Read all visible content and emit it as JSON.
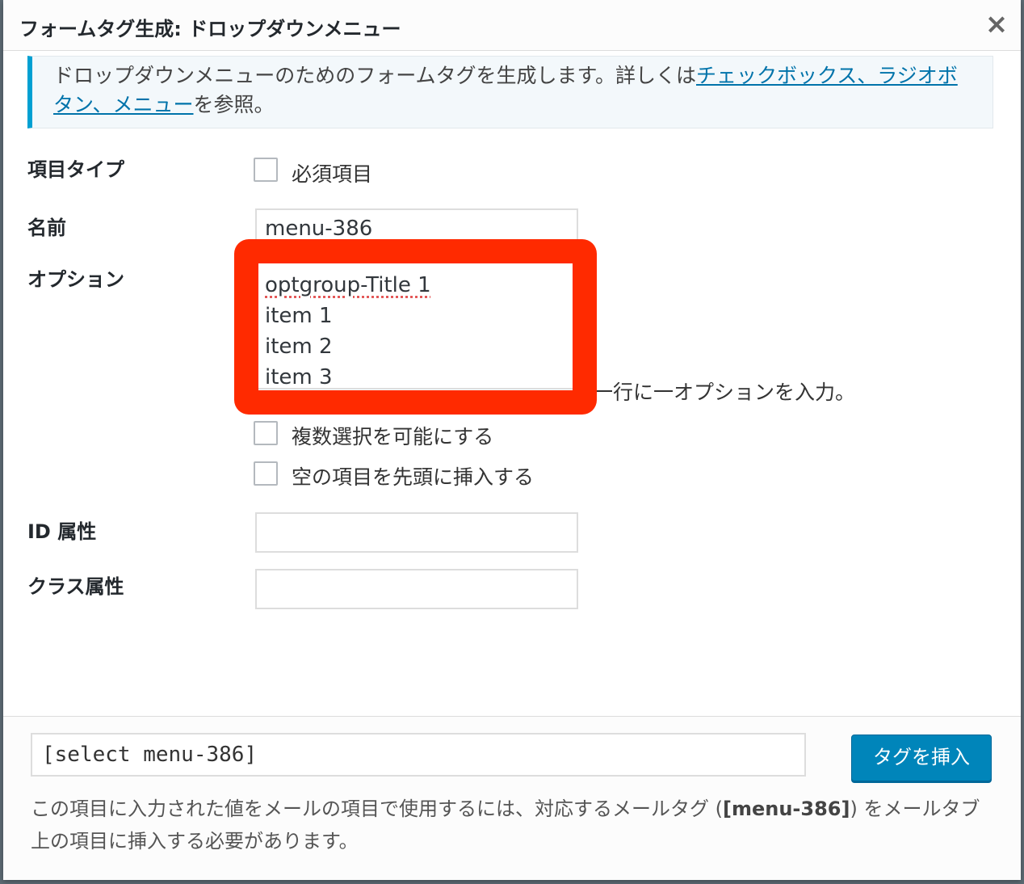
{
  "dialog": {
    "title": "フォームタグ生成: ドロップダウンメニュー",
    "close_icon": "×"
  },
  "notice": {
    "text_before": "ドロップダウンメニューのためのフォームタグを生成します。詳しくは",
    "link_text": "チェックボックス、ラジオボタン、メニュー",
    "text_after": "を参照。"
  },
  "form": {
    "field_type_label": "項目タイプ",
    "required_label": "必須項目",
    "name_label": "名前",
    "name_value": "menu-386",
    "options_label": "オプション",
    "options_lines": [
      "optgroup-Title 1",
      "item 1",
      "item 2",
      "item 3"
    ],
    "options_hint": "一行に一オプションを入力。",
    "multiple_label": "複数選択を可能にする",
    "blank_label": "空の項目を先頭に挿入する",
    "id_label": "ID 属性",
    "id_value": "",
    "class_label": "クラス属性",
    "class_value": ""
  },
  "footer": {
    "tag_value": "[select menu-386]",
    "insert_button": "タグを挿入",
    "desc_before": "この項目に入力された値をメールの項目で使用するには、対応するメールタグ (",
    "desc_tag": "[menu-386]",
    "desc_after": ") をメールタブ上の項目に挿入する必要があります。"
  },
  "colors": {
    "highlight_frame": "#ff2a00",
    "primary_button": "#0085ba",
    "link": "#0073aa",
    "notice_border": "#00a0d2"
  }
}
